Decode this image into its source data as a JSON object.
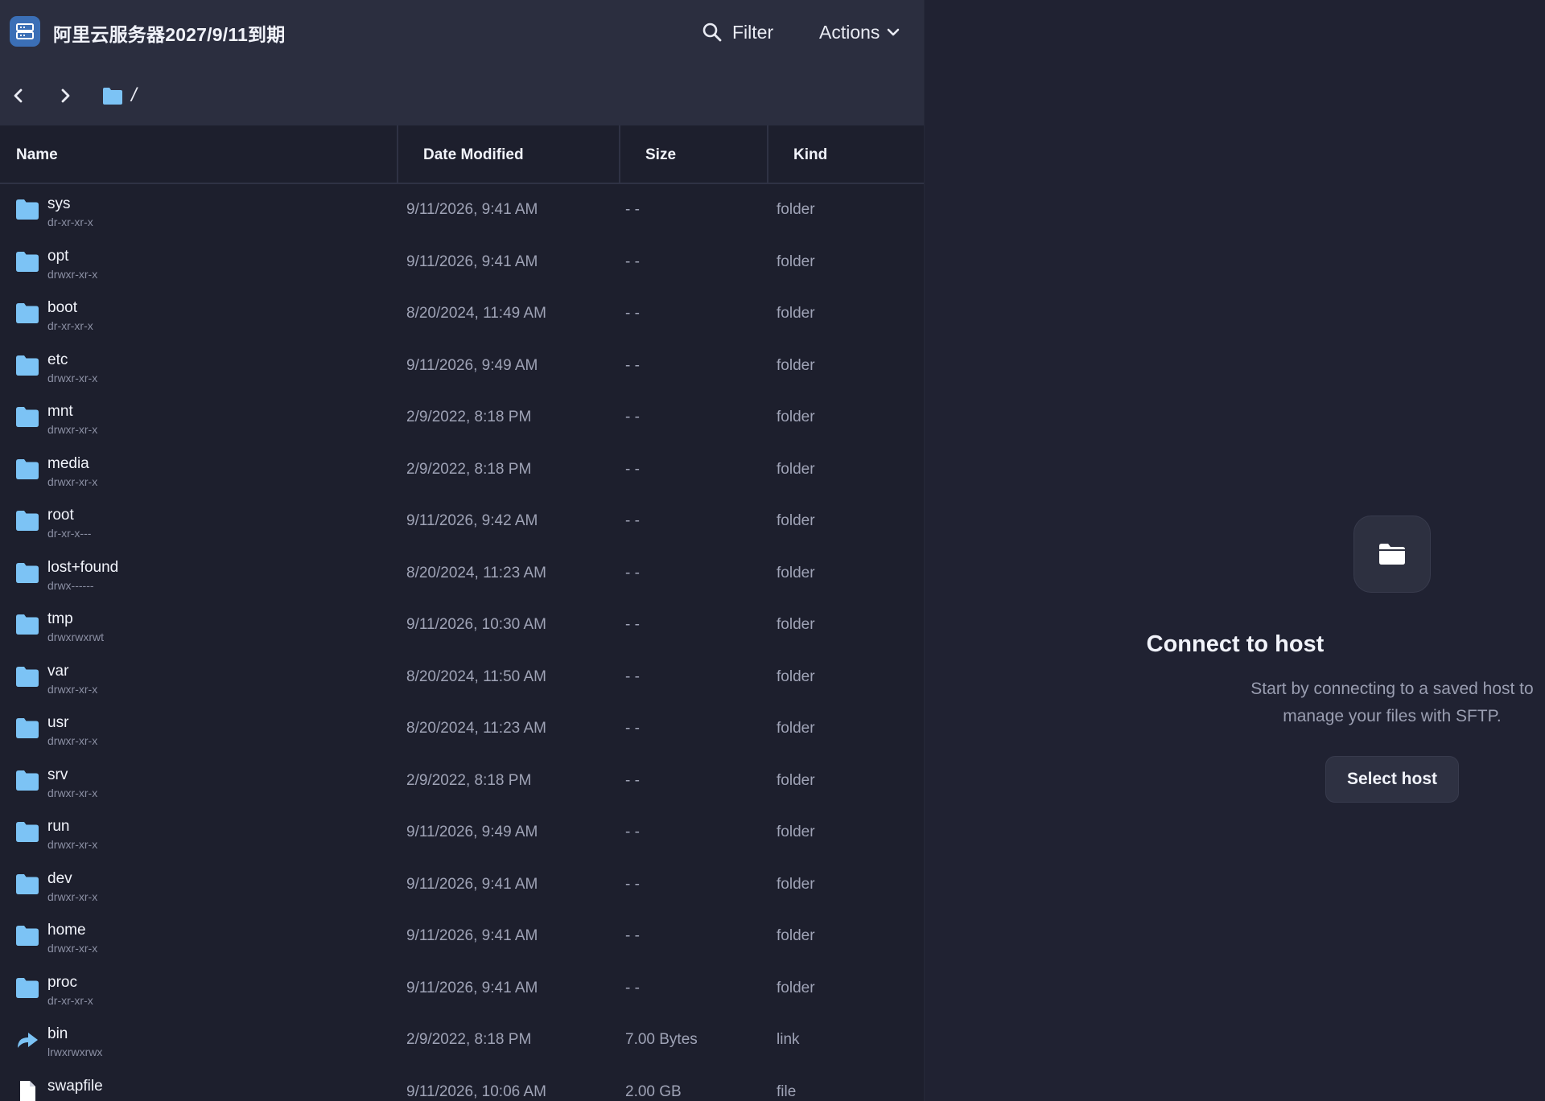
{
  "header": {
    "host_title": "阿里云服务器2027/9/11到期",
    "filter_label": "Filter",
    "actions_label": "Actions"
  },
  "breadcrumb": {
    "path": "/"
  },
  "table": {
    "columns": {
      "name": "Name",
      "date": "Date Modified",
      "size": "Size",
      "kind": "Kind"
    },
    "rows": [
      {
        "icon": "folder-icon",
        "name": "sys",
        "perm": "dr-xr-xr-x",
        "date": "9/11/2026, 9:41 AM",
        "size": "- -",
        "kind": "folder"
      },
      {
        "icon": "folder-icon",
        "name": "opt",
        "perm": "drwxr-xr-x",
        "date": "9/11/2026, 9:41 AM",
        "size": "- -",
        "kind": "folder"
      },
      {
        "icon": "folder-icon",
        "name": "boot",
        "perm": "dr-xr-xr-x",
        "date": "8/20/2024, 11:49 AM",
        "size": "- -",
        "kind": "folder"
      },
      {
        "icon": "folder-icon",
        "name": "etc",
        "perm": "drwxr-xr-x",
        "date": "9/11/2026, 9:49 AM",
        "size": "- -",
        "kind": "folder"
      },
      {
        "icon": "folder-icon",
        "name": "mnt",
        "perm": "drwxr-xr-x",
        "date": "2/9/2022, 8:18 PM",
        "size": "- -",
        "kind": "folder"
      },
      {
        "icon": "folder-icon",
        "name": "media",
        "perm": "drwxr-xr-x",
        "date": "2/9/2022, 8:18 PM",
        "size": "- -",
        "kind": "folder"
      },
      {
        "icon": "folder-icon",
        "name": "root",
        "perm": "dr-xr-x---",
        "date": "9/11/2026, 9:42 AM",
        "size": "- -",
        "kind": "folder"
      },
      {
        "icon": "folder-icon",
        "name": "lost+found",
        "perm": "drwx------",
        "date": "8/20/2024, 11:23 AM",
        "size": "- -",
        "kind": "folder"
      },
      {
        "icon": "folder-icon",
        "name": "tmp",
        "perm": "drwxrwxrwt",
        "date": "9/11/2026, 10:30 AM",
        "size": "- -",
        "kind": "folder"
      },
      {
        "icon": "folder-icon",
        "name": "var",
        "perm": "drwxr-xr-x",
        "date": "8/20/2024, 11:50 AM",
        "size": "- -",
        "kind": "folder"
      },
      {
        "icon": "folder-icon",
        "name": "usr",
        "perm": "drwxr-xr-x",
        "date": "8/20/2024, 11:23 AM",
        "size": "- -",
        "kind": "folder"
      },
      {
        "icon": "folder-icon",
        "name": "srv",
        "perm": "drwxr-xr-x",
        "date": "2/9/2022, 8:18 PM",
        "size": "- -",
        "kind": "folder"
      },
      {
        "icon": "folder-icon",
        "name": "run",
        "perm": "drwxr-xr-x",
        "date": "9/11/2026, 9:49 AM",
        "size": "- -",
        "kind": "folder"
      },
      {
        "icon": "folder-icon",
        "name": "dev",
        "perm": "drwxr-xr-x",
        "date": "9/11/2026, 9:41 AM",
        "size": "- -",
        "kind": "folder"
      },
      {
        "icon": "folder-icon",
        "name": "home",
        "perm": "drwxr-xr-x",
        "date": "9/11/2026, 9:41 AM",
        "size": "- -",
        "kind": "folder"
      },
      {
        "icon": "folder-icon",
        "name": "proc",
        "perm": "dr-xr-xr-x",
        "date": "9/11/2026, 9:41 AM",
        "size": "- -",
        "kind": "folder"
      },
      {
        "icon": "link-icon",
        "name": "bin",
        "perm": "lrwxrwxrwx",
        "date": "2/9/2022, 8:18 PM",
        "size": "7.00 Bytes",
        "kind": "link"
      },
      {
        "icon": "file-icon",
        "name": "swapfile",
        "perm": "",
        "date": "9/11/2026, 10:06 AM",
        "size": "2.00 GB",
        "kind": "file"
      }
    ]
  },
  "connect_panel": {
    "title": "Connect to host",
    "description": "Start by connecting to a saved host to manage your files with SFTP.",
    "button_label": "Select host"
  },
  "colors": {
    "folder": "#7cc3f5",
    "accent": "#3b6fb6",
    "background": "#1f2131"
  }
}
